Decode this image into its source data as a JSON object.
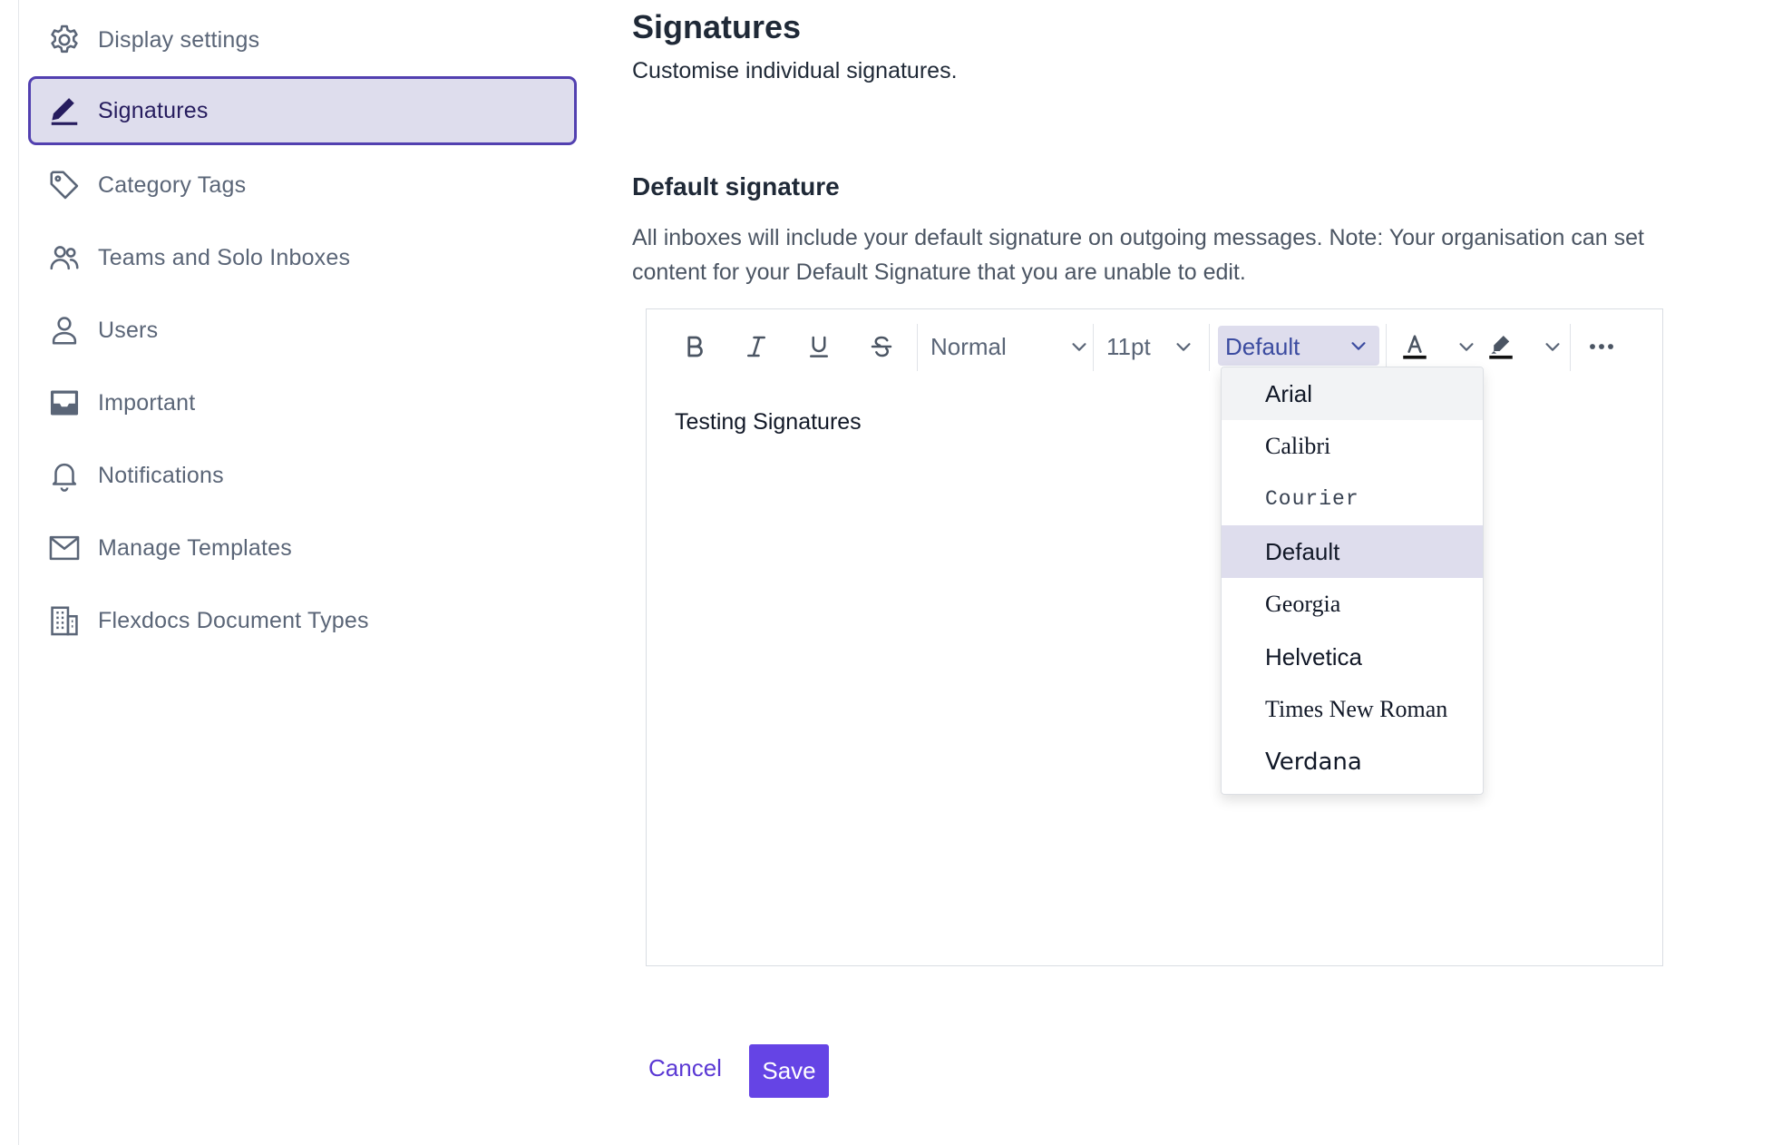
{
  "sidebar": {
    "items": [
      {
        "label": "Display settings",
        "icon": "gear-icon",
        "active": false
      },
      {
        "label": "Signatures",
        "icon": "pen-icon",
        "active": true
      },
      {
        "label": "Category Tags",
        "icon": "tag-icon",
        "active": false
      },
      {
        "label": "Teams and Solo Inboxes",
        "icon": "users-icon",
        "active": false
      },
      {
        "label": "Users",
        "icon": "user-icon",
        "active": false
      },
      {
        "label": "Important",
        "icon": "inbox-icon",
        "active": false
      },
      {
        "label": "Notifications",
        "icon": "bell-icon",
        "active": false
      },
      {
        "label": "Manage Templates",
        "icon": "envelope-icon",
        "active": false
      },
      {
        "label": "Flexdocs Document Types",
        "icon": "building-icon",
        "active": false
      }
    ]
  },
  "main": {
    "title": "Signatures",
    "subtitle": "Customise individual signatures.",
    "section_title": "Default signature",
    "section_description": "All inboxes will include your default signature on outgoing messages. Note: Your organisation can set content for your Default Signature that you are unable to edit."
  },
  "editor": {
    "toolbar": {
      "paragraph_style": "Normal",
      "font_size": "11pt",
      "font_family": "Default"
    },
    "content": "Testing Signatures",
    "font_dropdown": {
      "options": [
        "Arial",
        "Calibri",
        "Courier",
        "Default",
        "Georgia",
        "Helvetica",
        "Times New Roman",
        "Verdana"
      ],
      "hovered": "Arial",
      "selected": "Default"
    }
  },
  "actions": {
    "cancel_label": "Cancel",
    "save_label": "Save"
  },
  "colors": {
    "accent": "#6544e5",
    "active_border": "#5240b0",
    "active_bg": "#dedded",
    "text_muted": "#5a6577"
  }
}
